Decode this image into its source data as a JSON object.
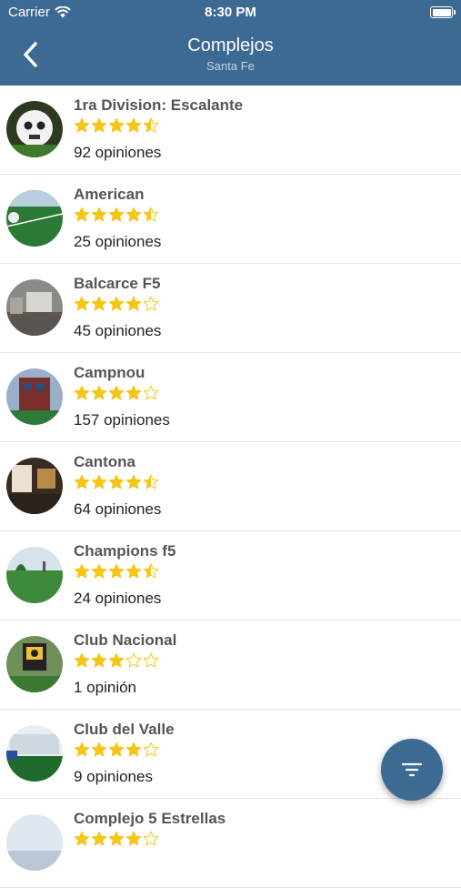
{
  "status_bar": {
    "carrier": "Carrier",
    "time": "8:30 PM"
  },
  "header": {
    "title": "Complejos",
    "subtitle": "Santa Fe",
    "back_icon": "chevron-left-icon"
  },
  "colors": {
    "header": "#3d6a93",
    "star": "#f5c518",
    "fab": "#3d6a93"
  },
  "complexes": [
    {
      "name": "1ra Division: Escalante",
      "rating": 4.5,
      "reviews": "92 opiniones"
    },
    {
      "name": "American",
      "rating": 4.5,
      "reviews": "25 opiniones"
    },
    {
      "name": "Balcarce F5",
      "rating": 4,
      "reviews": "45 opiniones"
    },
    {
      "name": "Campnou",
      "rating": 4,
      "reviews": "157 opiniones"
    },
    {
      "name": "Cantona",
      "rating": 4.5,
      "reviews": "64 opiniones"
    },
    {
      "name": "Champions f5",
      "rating": 4.5,
      "reviews": "24 opiniones"
    },
    {
      "name": "Club Nacional",
      "rating": 3,
      "reviews": "1 opinión"
    },
    {
      "name": "Club del Valle",
      "rating": 4,
      "reviews": "9 opiniones"
    },
    {
      "name": "Complejo 5 Estrellas",
      "rating": 4,
      "reviews": ""
    }
  ],
  "fab": {
    "icon": "filter-icon"
  }
}
